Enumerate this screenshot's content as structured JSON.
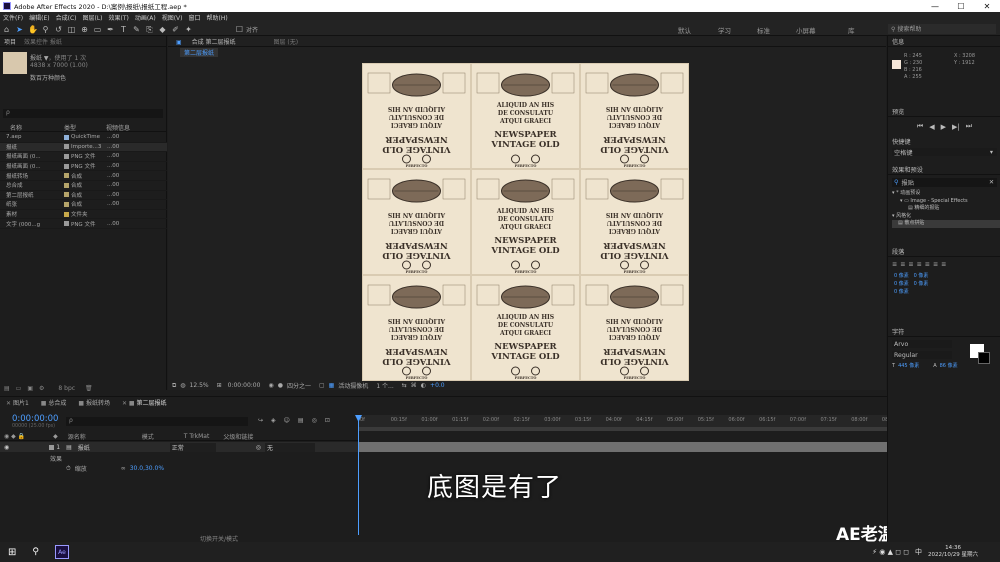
{
  "window": {
    "title": "Adobe After Effects 2020 - D:\\案例\\报纸\\报纸工程.aep *",
    "min": "—",
    "max": "☐",
    "close": "✕"
  },
  "menu": [
    "文件(F)",
    "编辑(E)",
    "合成(C)",
    "图层(L)",
    "效果(T)",
    "动画(A)",
    "视图(V)",
    "窗口",
    "帮助(H)"
  ],
  "toolbar": {
    "snap_label": "对齐",
    "workspaces": [
      "默认",
      "学习",
      "标准",
      "小屏幕",
      "库"
    ],
    "search_placeholder": "搜索帮助"
  },
  "project": {
    "tab_project": "项目",
    "tab_effect": "效果控件 报纸",
    "item_name": "报纸 ▼",
    "item_used": "，使用了 1 次",
    "item_dims": "4838 x 7000 (1.00)",
    "item_colors": "数百万种颜色",
    "col_name": "名称",
    "col_type": "类型",
    "col_size": "视频信息",
    "search_placeholder": "ρ",
    "rows": [
      {
        "name": "7.aep",
        "type": "QuickTime",
        "size": "...00",
        "color": "#8fb1d9"
      },
      {
        "name": "报纸",
        "type": "Importe...3",
        "size": "...00",
        "color": "#9a9a9a"
      },
      {
        "name": "报纸画面 (0...",
        "type": "PNG 文件",
        "size": "...00",
        "color": "#9a9a9a"
      },
      {
        "name": "报纸画面 (0...",
        "type": "PNG 文件",
        "size": "...00",
        "color": "#9a9a9a"
      },
      {
        "name": "报纸转场",
        "type": "合成",
        "size": "...00",
        "color": "#b5a46a"
      },
      {
        "name": "总合成",
        "type": "合成",
        "size": "...00",
        "color": "#b5a46a"
      },
      {
        "name": "第二层报纸",
        "type": "合成",
        "size": "...00",
        "color": "#b5a46a"
      },
      {
        "name": "纸张",
        "type": "合成",
        "size": "...00",
        "color": "#b5a46a"
      },
      {
        "name": "素材",
        "type": "文件夹",
        "size": "",
        "color": "#c7a94a"
      },
      {
        "name": "文字 (000...g",
        "type": "PNG 文件",
        "size": "...00",
        "color": "#9a9a9a"
      }
    ],
    "bpc": "8 bpc"
  },
  "viewer": {
    "tab": "合成 第二层报纸",
    "tab2": "图层 (无)",
    "breadcrumb": "第二层报纸",
    "zoom": "12.5%",
    "timecode": "0:00:00:00",
    "quality": "四分之一",
    "camera": "活动摄像机",
    "views": "1 个...",
    "exposure": "+0.0"
  },
  "timeline": {
    "tabs": [
      "图片1",
      "总合成",
      "报纸转场",
      "第二层报纸"
    ],
    "timecode": "0:00:00:00",
    "fps": "00000 (25.00 fps)",
    "search_placeholder": "ρ",
    "col_layer": "源名称",
    "col_mode": "模式",
    "col_trkmat": "T TrkMat",
    "col_parent": "父级和链接",
    "layer_num": "1",
    "layer_name": "报纸",
    "layer_mode": "正常",
    "parent": "无",
    "sub_transform": "效果",
    "sub_scale": "缩放",
    "scale_value": "30.0,30.0%",
    "bottom_label": "切换开关/模式",
    "ruler": [
      "0f",
      "00:15f",
      "01:00f",
      "01:15f",
      "02:00f",
      "02:15f",
      "03:00f",
      "03:15f",
      "04:00f",
      "04:15f",
      "05:00f",
      "05:15f",
      "06:00f",
      "06:15f",
      "07:00f",
      "07:15f",
      "08:00f",
      "08:15f",
      "09:00f",
      "09:15f",
      "10:00f"
    ]
  },
  "info": {
    "title": "信息",
    "r": "R : 245",
    "g": "G : 230",
    "b": "B : 216",
    "a": "A : 255",
    "x": "X : 3208",
    "y": "Y : 1912",
    "swatch": "#f5e6d8"
  },
  "preview": {
    "title": "预览"
  },
  "bookmarks": {
    "title": "快捷键",
    "value": "空格键"
  },
  "effects": {
    "title": "效果和预设",
    "search": "报贴",
    "group1": "动画预设",
    "item1": "Image - Special Effects",
    "item1b": "精细的报贴",
    "group2": "风格化",
    "item2": "散点拼贴"
  },
  "paragraph": {
    "title": "段落",
    "v1": "0 像素",
    "v2": "0 像素",
    "v3": "0 像素",
    "v4": "0 像素",
    "v5": "0 像素"
  },
  "character": {
    "title": "字符",
    "font": "Arvo",
    "style": "Regular",
    "size": "445 像素",
    "leading": "86 像素"
  },
  "subtitle": "底图是有了",
  "watermark": "AE老温",
  "taskbar": {
    "time": "14:36",
    "date": "2022/10/29 星期六",
    "ime": "中"
  },
  "newspaper": {
    "headline1": "VINTAGE OLD",
    "headline2": "NEWSPAPER",
    "body1": "ATQUI GRAECI",
    "body2": "DE CONSULATU",
    "body3": "ALIQUID AN HIS",
    "small": "PERFECTO"
  }
}
